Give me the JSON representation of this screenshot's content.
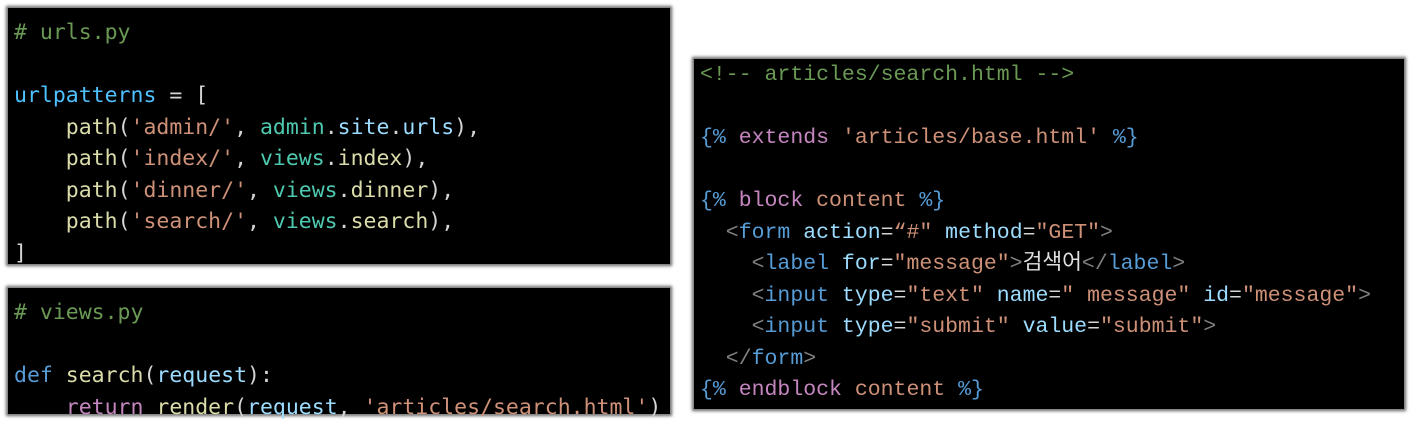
{
  "colors": {
    "comment": "#6a9955",
    "variable": "#4fc1ff",
    "function": "#dcdcaa",
    "string": "#ce9178",
    "type": "#4ec9b0",
    "keyword": "#569cd6",
    "control": "#c586c0",
    "punct": "#d4d4d4",
    "attr": "#9cdcfe",
    "tag_bracket": "#808080",
    "background": "#000000"
  },
  "blocks": [
    {
      "name": "urls-py-code",
      "lines": [
        [
          [
            "# urls.py",
            "c"
          ]
        ],
        [],
        [
          [
            "urlpatterns",
            "v"
          ],
          [
            " = [",
            "p"
          ]
        ],
        [
          [
            "    path",
            "f"
          ],
          [
            "(",
            "p"
          ],
          [
            "'admin/'",
            "s"
          ],
          [
            ", ",
            "p"
          ],
          [
            "admin",
            "t"
          ],
          [
            ".",
            "p"
          ],
          [
            "site",
            "a"
          ],
          [
            ".",
            "p"
          ],
          [
            "urls",
            "a"
          ],
          [
            "),",
            "p"
          ]
        ],
        [
          [
            "    path",
            "f"
          ],
          [
            "(",
            "p"
          ],
          [
            "'index/'",
            "s"
          ],
          [
            ", ",
            "p"
          ],
          [
            "views",
            "t"
          ],
          [
            ".",
            "p"
          ],
          [
            "index",
            "f"
          ],
          [
            "),",
            "p"
          ]
        ],
        [
          [
            "    path",
            "f"
          ],
          [
            "(",
            "p"
          ],
          [
            "'dinner/'",
            "s"
          ],
          [
            ", ",
            "p"
          ],
          [
            "views",
            "t"
          ],
          [
            ".",
            "p"
          ],
          [
            "dinner",
            "f"
          ],
          [
            "),",
            "p"
          ]
        ],
        [
          [
            "    path",
            "f"
          ],
          [
            "(",
            "p"
          ],
          [
            "'search/'",
            "s"
          ],
          [
            ", ",
            "p"
          ],
          [
            "views",
            "t"
          ],
          [
            ".",
            "p"
          ],
          [
            "search",
            "f"
          ],
          [
            "),",
            "p"
          ]
        ],
        [
          [
            "]",
            "p"
          ]
        ]
      ]
    },
    {
      "name": "views-py-code",
      "lines": [
        [
          [
            "# views.py",
            "c"
          ]
        ],
        [],
        [
          [
            "def",
            "k"
          ],
          [
            " ",
            "p"
          ],
          [
            "search",
            "f"
          ],
          [
            "(",
            "p"
          ],
          [
            "request",
            "a"
          ],
          [
            "):",
            "p"
          ]
        ],
        [
          [
            "    ",
            "p"
          ],
          [
            "return",
            "r"
          ],
          [
            " ",
            "p"
          ],
          [
            "render",
            "f"
          ],
          [
            "(",
            "p"
          ],
          [
            "request",
            "a"
          ],
          [
            ", ",
            "p"
          ],
          [
            "'articles/search.html'",
            "s"
          ],
          [
            ")",
            "p"
          ]
        ]
      ]
    },
    {
      "name": "search-html-code",
      "lines": [
        [
          [
            "<!-- articles/search.html -->",
            "c"
          ]
        ],
        [],
        [
          [
            "{%",
            "k"
          ],
          [
            " extends ",
            "r"
          ],
          [
            "'articles/base.html'",
            "s"
          ],
          [
            " %}",
            "k"
          ]
        ],
        [],
        [
          [
            "{%",
            "k"
          ],
          [
            " block ",
            "r"
          ],
          [
            "content",
            "s"
          ],
          [
            " %}",
            "k"
          ]
        ],
        [
          [
            "  <",
            "g"
          ],
          [
            "form",
            "k"
          ],
          [
            " action",
            "a"
          ],
          [
            "=",
            "p"
          ],
          [
            "“#\"",
            "s"
          ],
          [
            " method",
            "a"
          ],
          [
            "=",
            "p"
          ],
          [
            "\"GET\"",
            "s"
          ],
          [
            ">",
            "g"
          ]
        ],
        [
          [
            "    <",
            "g"
          ],
          [
            "label",
            "k"
          ],
          [
            " for",
            "a"
          ],
          [
            "=",
            "p"
          ],
          [
            "\"message\"",
            "s"
          ],
          [
            ">",
            "g"
          ],
          [
            "검색어",
            "w"
          ],
          [
            "</",
            "g"
          ],
          [
            "label",
            "k"
          ],
          [
            ">",
            "g"
          ]
        ],
        [
          [
            "    <",
            "g"
          ],
          [
            "input",
            "k"
          ],
          [
            " type",
            "a"
          ],
          [
            "=",
            "p"
          ],
          [
            "\"text\"",
            "s"
          ],
          [
            " name",
            "a"
          ],
          [
            "=",
            "p"
          ],
          [
            "\" message\"",
            "s"
          ],
          [
            " id",
            "a"
          ],
          [
            "=",
            "p"
          ],
          [
            "\"message\"",
            "s"
          ],
          [
            ">",
            "g"
          ]
        ],
        [
          [
            "    <",
            "g"
          ],
          [
            "input",
            "k"
          ],
          [
            " type",
            "a"
          ],
          [
            "=",
            "p"
          ],
          [
            "\"submit\"",
            "s"
          ],
          [
            " value",
            "a"
          ],
          [
            "=",
            "p"
          ],
          [
            "\"submit\"",
            "s"
          ],
          [
            ">",
            "g"
          ]
        ],
        [
          [
            "  </",
            "g"
          ],
          [
            "form",
            "k"
          ],
          [
            ">",
            "g"
          ]
        ],
        [
          [
            "{%",
            "k"
          ],
          [
            " endblock ",
            "r"
          ],
          [
            "content",
            "s"
          ],
          [
            " %}",
            "k"
          ]
        ]
      ]
    }
  ]
}
